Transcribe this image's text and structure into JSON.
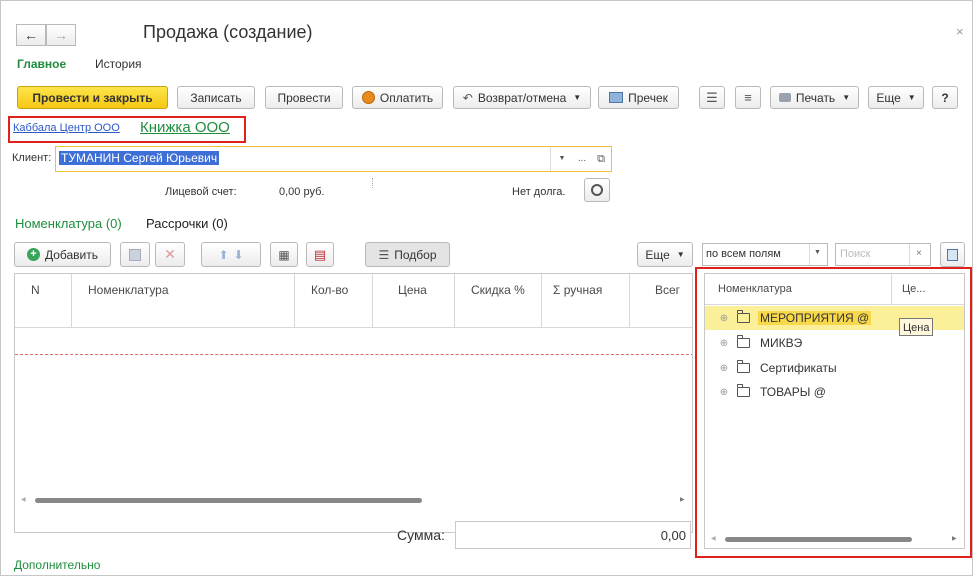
{
  "window": {
    "title": "Продажа (создание)",
    "close_symbol": "×"
  },
  "nav": {
    "back_icon": "arrow-left-icon",
    "forward_icon": "arrow-right-icon",
    "tabs": [
      {
        "label": "Главное",
        "active": true
      },
      {
        "label": "История",
        "active": false
      }
    ]
  },
  "toolbar": {
    "post_close": "Провести и закрыть",
    "save": "Записать",
    "post": "Провести",
    "pay": "Оплатить",
    "return_cancel": "Возврат/отмена",
    "receipt": "Пречек",
    "print": "Печать",
    "more": "Еще",
    "help": "?"
  },
  "org_links": {
    "first": "Каббала Центр ООО",
    "second": "Книжка ООО"
  },
  "client": {
    "label": "Клиент:",
    "value": "ТУМАНИН Сергей Юрьевич",
    "clear": "..."
  },
  "account": {
    "label": "Лицевой счет:",
    "value": "0,00 руб.",
    "debt": "Нет долга."
  },
  "section_tabs": [
    {
      "label": "Номенклатура (0)",
      "active": true
    },
    {
      "label": "Рассрочки (0)",
      "active": false
    }
  ],
  "table_toolbar": {
    "add": "Добавить",
    "pick": "Подбор",
    "more": "Еще",
    "search_mode": "по всем полям",
    "search_placeholder": "Поиск",
    "search_clear": "×"
  },
  "table": {
    "columns": [
      "N",
      "Номенклатура",
      "Кол-во",
      "Цена",
      "Скидка %",
      "Σ ручная",
      "Всег"
    ]
  },
  "sum": {
    "label": "Сумма:",
    "value": "0,00"
  },
  "tree": {
    "columns": [
      "Номенклатура",
      "Це..."
    ],
    "items": [
      {
        "label": "МЕРОПРИЯТИЯ @",
        "selected": true
      },
      {
        "label": "МИКВЭ",
        "selected": false
      },
      {
        "label": "Сертификаты",
        "selected": false
      },
      {
        "label": "ТОВАРЫ @",
        "selected": false
      }
    ],
    "tooltip": "Цена"
  },
  "footer": {
    "additional": "Дополнительно"
  },
  "colors": {
    "accent_green": "#1e8e3e",
    "primary_yellow": "#f5c814",
    "highlight_red": "#e0201a",
    "selection_yellow": "#fcef9a",
    "link_blue": "#2b58c8"
  }
}
